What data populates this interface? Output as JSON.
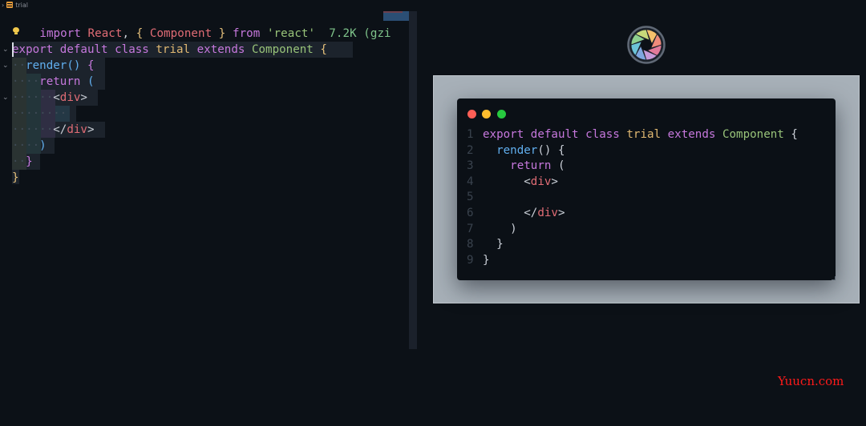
{
  "editor": {
    "breadcrumb": {
      "file_name": "trial"
    },
    "import_line": {
      "import_kw": "import",
      "react": "React",
      "comma": ",",
      "brace_open": "{",
      "component": "Component",
      "brace_close": "}",
      "from_kw": "from",
      "module": "'react'",
      "size_hint": "7.2K (gzi"
    },
    "code_lines": [
      {
        "indent": "",
        "tokens": [
          {
            "t": "export default class ",
            "c": "kw"
          },
          {
            "t": "trial ",
            "c": "tn"
          },
          {
            "t": "extends ",
            "c": "kw"
          },
          {
            "t": "Component ",
            "c": "gr"
          },
          {
            "t": "{",
            "c": "yl"
          }
        ]
      },
      {
        "indent": "··",
        "tokens": [
          {
            "t": "render",
            "c": "bl"
          },
          {
            "t": "() ",
            "c": "bl"
          },
          {
            "t": "{",
            "c": "pk"
          }
        ]
      },
      {
        "indent": "····",
        "tokens": [
          {
            "t": "return ",
            "c": "kw"
          },
          {
            "t": "(",
            "c": "bl"
          }
        ]
      },
      {
        "indent": "······",
        "tokens": [
          {
            "t": "<",
            "c": "wh"
          },
          {
            "t": "div",
            "c": "rd"
          },
          {
            "t": ">",
            "c": "wh"
          }
        ]
      },
      {
        "indent": "········",
        "tokens": []
      },
      {
        "indent": "······",
        "tokens": [
          {
            "t": "</",
            "c": "wh"
          },
          {
            "t": "div",
            "c": "rd"
          },
          {
            "t": ">",
            "c": "wh"
          }
        ]
      },
      {
        "indent": "····",
        "tokens": [
          {
            "t": ")",
            "c": "bl"
          }
        ]
      },
      {
        "indent": "··",
        "tokens": [
          {
            "t": "}",
            "c": "pk"
          }
        ]
      },
      {
        "indent": "",
        "tokens": [
          {
            "t": "}",
            "c": "yl"
          }
        ]
      }
    ]
  },
  "preview": {
    "window_code": [
      {
        "n": "1",
        "tokens": [
          {
            "t": "export default class ",
            "c": "kw"
          },
          {
            "t": "trial ",
            "c": "tn"
          },
          {
            "t": "extends ",
            "c": "kw"
          },
          {
            "t": "Component ",
            "c": "gr"
          },
          {
            "t": "{",
            "c": "wh"
          }
        ]
      },
      {
        "n": "2",
        "tokens": [
          {
            "t": "  ",
            "c": "wh"
          },
          {
            "t": "render",
            "c": "bl"
          },
          {
            "t": "() {",
            "c": "wh"
          }
        ]
      },
      {
        "n": "3",
        "tokens": [
          {
            "t": "    ",
            "c": "wh"
          },
          {
            "t": "return ",
            "c": "kw"
          },
          {
            "t": "(",
            "c": "wh"
          }
        ]
      },
      {
        "n": "4",
        "tokens": [
          {
            "t": "      <",
            "c": "wh"
          },
          {
            "t": "div",
            "c": "rd"
          },
          {
            "t": ">",
            "c": "wh"
          }
        ]
      },
      {
        "n": "5",
        "tokens": []
      },
      {
        "n": "6",
        "tokens": [
          {
            "t": "      </",
            "c": "wh"
          },
          {
            "t": "div",
            "c": "rd"
          },
          {
            "t": ">",
            "c": "wh"
          }
        ]
      },
      {
        "n": "7",
        "tokens": [
          {
            "t": "    )",
            "c": "wh"
          }
        ]
      },
      {
        "n": "8",
        "tokens": [
          {
            "t": "  }",
            "c": "wh"
          }
        ]
      },
      {
        "n": "9",
        "tokens": [
          {
            "t": "}",
            "c": "wh"
          }
        ]
      }
    ]
  },
  "watermark": "Yuucn.com",
  "colors": {
    "background": "#0c1117",
    "keyword": "#c678dd",
    "string": "#98c379",
    "tag": "#e06c75",
    "function": "#61afef",
    "brace": "#e5c07b",
    "traffic_red": "#ff5f56",
    "traffic_yellow": "#ffbd2e",
    "traffic_green": "#27c93f",
    "watermark": "#ff1a1a"
  }
}
